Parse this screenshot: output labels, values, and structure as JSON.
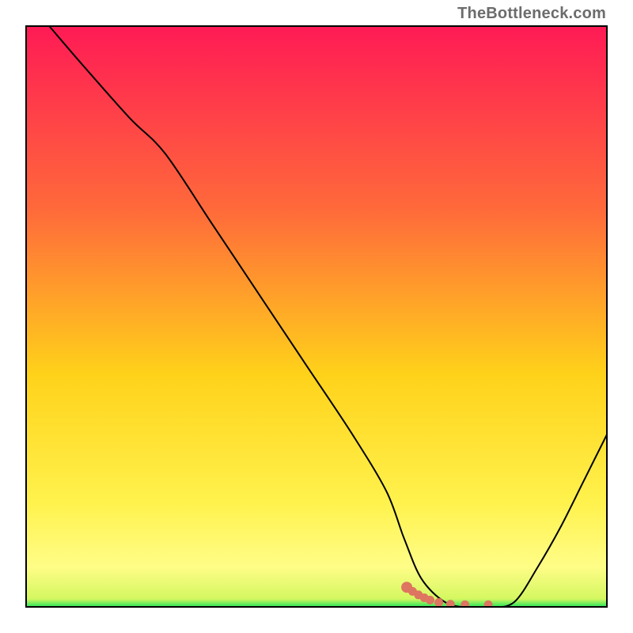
{
  "watermark": {
    "text": "TheBottleneck.com"
  },
  "colors": {
    "grad_top": "#ff1a55",
    "grad_mid1": "#ff6b3a",
    "grad_mid2": "#ffd21a",
    "grad_mid3": "#fff24d",
    "grad_bottom_y": "#fffd87",
    "grad_green": "#16e35a",
    "curve": "#000000",
    "marker": "#dd7560"
  },
  "chart_data": {
    "type": "line",
    "title": "",
    "xlabel": "",
    "ylabel": "",
    "xlim": [
      0,
      100
    ],
    "ylim": [
      0,
      100
    ],
    "series": [
      {
        "name": "bottleneck-curve",
        "x": [
          4,
          10,
          18,
          24,
          32,
          40,
          48,
          56,
          62,
          65,
          68,
          72,
          76,
          80,
          84,
          88,
          92,
          96,
          100
        ],
        "y": [
          100,
          93,
          84,
          78,
          66,
          54,
          42,
          30,
          20,
          12,
          5,
          1,
          0,
          0,
          1,
          7,
          14,
          22,
          30
        ]
      }
    ],
    "markers": {
      "name": "highlight-dots",
      "x": [
        65.5,
        66.5,
        67.5,
        68.5,
        69.5,
        71,
        73,
        75.5,
        79.5
      ],
      "y": [
        3.5,
        2.8,
        2.2,
        1.7,
        1.3,
        0.9,
        0.6,
        0.5,
        0.5
      ]
    },
    "gradient_stops": [
      {
        "pct": 0.0,
        "color": "#ff1a55"
      },
      {
        "pct": 0.32,
        "color": "#ff6b3a"
      },
      {
        "pct": 0.6,
        "color": "#ffd21a"
      },
      {
        "pct": 0.82,
        "color": "#fff24d"
      },
      {
        "pct": 0.93,
        "color": "#fffd87"
      },
      {
        "pct": 0.985,
        "color": "#d4f760"
      },
      {
        "pct": 1.0,
        "color": "#16e35a"
      }
    ]
  }
}
